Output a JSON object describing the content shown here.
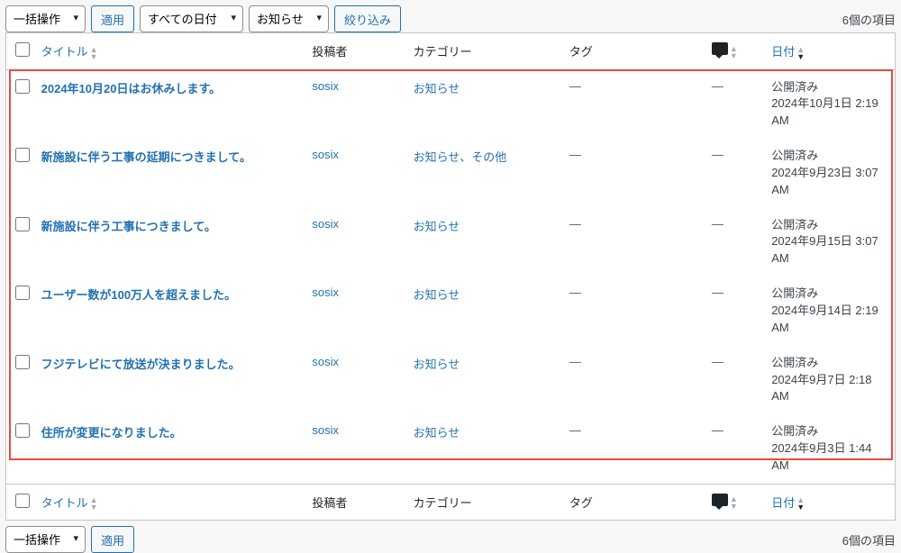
{
  "filters": {
    "bulk_action": "一括操作",
    "apply": "適用",
    "all_dates": "すべての日付",
    "category": "お知らせ",
    "filter_btn": "絞り込み"
  },
  "count_label": "6個の項目",
  "columns": {
    "title": "タイトル",
    "author": "投稿者",
    "categories": "カテゴリー",
    "tags": "タグ",
    "date": "日付"
  },
  "rows": [
    {
      "title": "2024年10月20日はお休みします。",
      "author": "sosix",
      "categories": "お知らせ",
      "tags": "—",
      "comments": "—",
      "date_status": "公開済み",
      "date_stamp": "2024年10月1日 2:19 AM"
    },
    {
      "title": "新施設に伴う工事の延期につきまして。",
      "author": "sosix",
      "categories": "お知らせ、その他",
      "tags": "—",
      "comments": "—",
      "date_status": "公開済み",
      "date_stamp": "2024年9月23日 3:07 AM"
    },
    {
      "title": "新施設に伴う工事につきまして。",
      "author": "sosix",
      "categories": "お知らせ",
      "tags": "—",
      "comments": "—",
      "date_status": "公開済み",
      "date_stamp": "2024年9月15日 3:07 AM"
    },
    {
      "title": "ユーザー数が100万人を超えました。",
      "author": "sosix",
      "categories": "お知らせ",
      "tags": "—",
      "comments": "—",
      "date_status": "公開済み",
      "date_stamp": "2024年9月14日 2:19 AM"
    },
    {
      "title": "フジテレビにて放送が決まりました。",
      "author": "sosix",
      "categories": "お知らせ",
      "tags": "—",
      "comments": "—",
      "date_status": "公開済み",
      "date_stamp": "2024年9月7日 2:18 AM"
    },
    {
      "title": "住所が変更になりました。",
      "author": "sosix",
      "categories": "お知らせ",
      "tags": "—",
      "comments": "—",
      "date_status": "公開済み",
      "date_stamp": "2024年9月3日 1:44 AM"
    }
  ]
}
